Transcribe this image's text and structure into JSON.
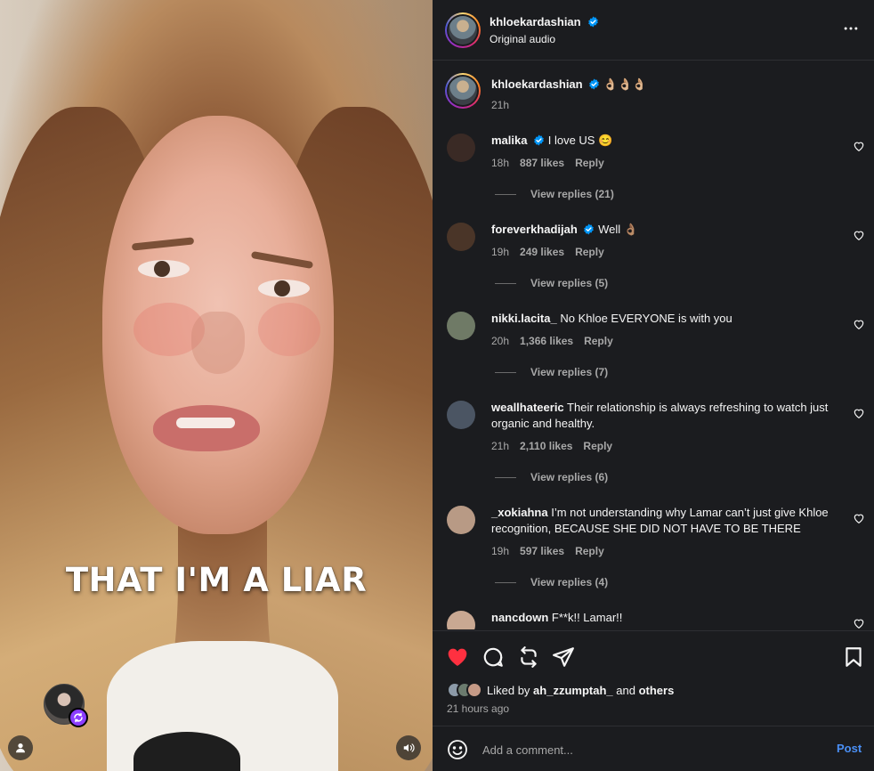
{
  "video": {
    "caption": "THAT I'M A LIAR",
    "icons": {
      "user": "user-icon",
      "mute": "speaker-icon",
      "remix": "remix-icon"
    }
  },
  "header": {
    "username": "khloekardashian",
    "audio": "Original audio",
    "more_icon": "more-horizontal-icon"
  },
  "post": {
    "username": "khloekardashian",
    "caption": "👌🏼👌🏼👌🏼",
    "time": "21h"
  },
  "comments": [
    {
      "user": "malika",
      "verified": true,
      "text": "I love US 😊",
      "time": "18h",
      "likes": "887 likes",
      "reply": "Reply",
      "view_replies": "View replies (21)",
      "avatar": "#3a2a25"
    },
    {
      "user": "foreverkhadijah",
      "verified": true,
      "text": "Well 👌🏽",
      "time": "19h",
      "likes": "249 likes",
      "reply": "Reply",
      "view_replies": "View replies (5)",
      "avatar": "#4a3528"
    },
    {
      "user": "nikki.lacita_",
      "verified": false,
      "text": "No Khloe EVERYONE is with you",
      "time": "20h",
      "likes": "1,366 likes",
      "reply": "Reply",
      "view_replies": "View replies (7)",
      "avatar": "#6f7a66"
    },
    {
      "user": "weallhateeric",
      "verified": false,
      "text": "Their relationship is always refreshing to watch just organic and healthy.",
      "time": "21h",
      "likes": "2,110 likes",
      "reply": "Reply",
      "view_replies": "View replies (6)",
      "avatar": "#4b5563"
    },
    {
      "user": "_xokiahna",
      "verified": false,
      "text": "I’m not understanding why Lamar can’t just give Khloe recognition, BECAUSE SHE DID NOT HAVE TO BE THERE",
      "time": "19h",
      "likes": "597 likes",
      "reply": "Reply",
      "view_replies": "View replies (4)",
      "avatar": "#b89a85"
    },
    {
      "user": "nancdown",
      "verified": false,
      "text": "F**k!! Lamar!!",
      "avatar": "#c9a892"
    }
  ],
  "actions": {
    "liked_prefix": "Liked by",
    "liked_user": "ah_zzumptah_",
    "liked_and": "and",
    "liked_others": "others",
    "time_ago": "21 hours ago",
    "like_color": "#ff3040"
  },
  "add_comment": {
    "placeholder": "Add a comment...",
    "post_label": "Post",
    "post_color": "#4a8ff5"
  }
}
